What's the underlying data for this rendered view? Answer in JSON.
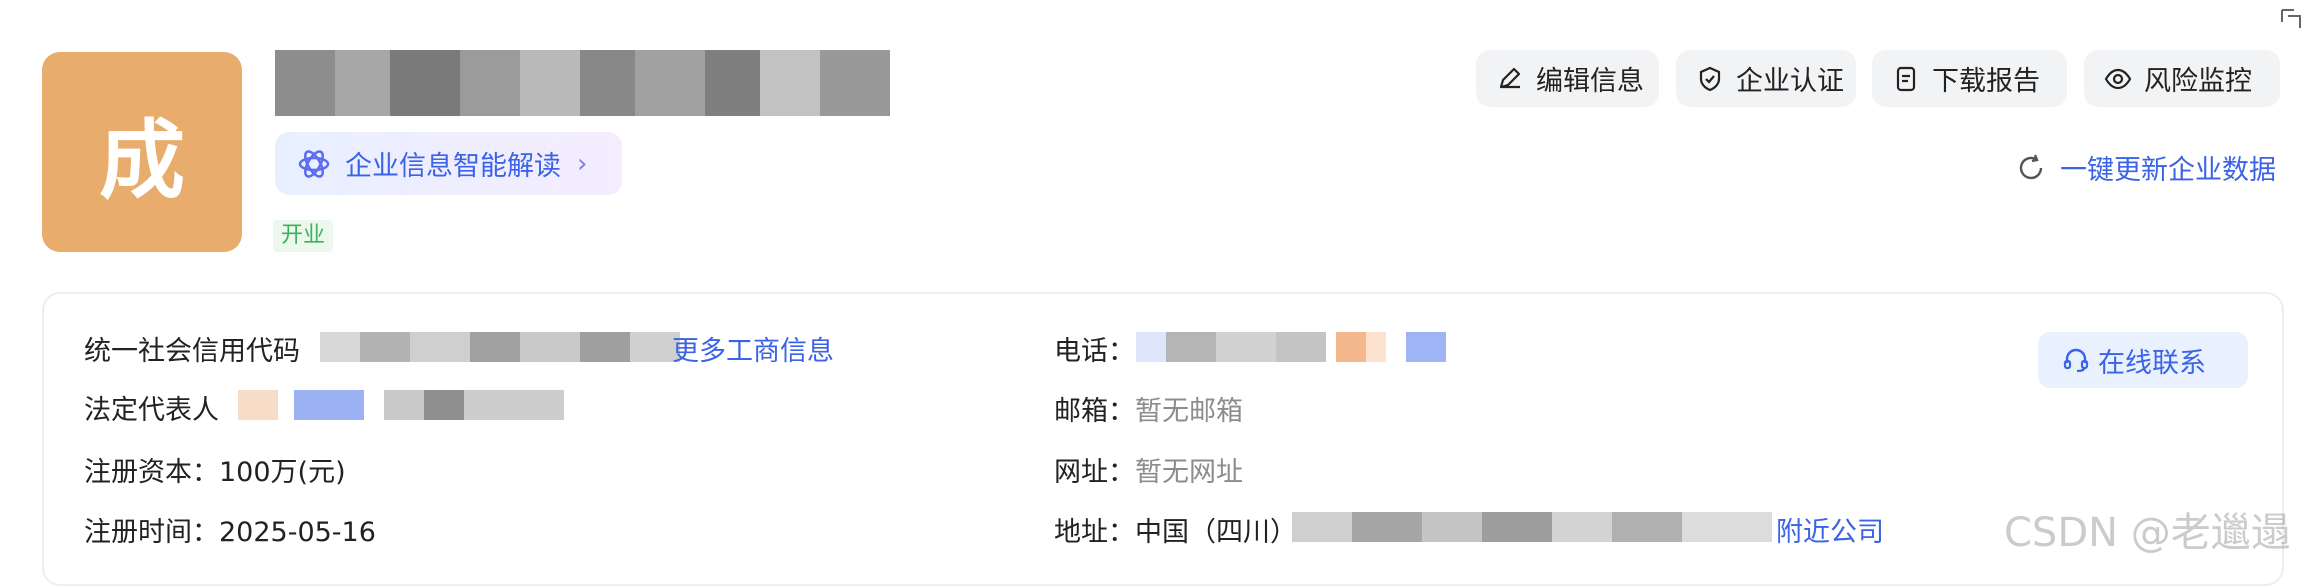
{
  "company": {
    "avatar_char": "成",
    "ai_summary_label": "企业信息智能解读",
    "status": "开业"
  },
  "actions": {
    "edit": "编辑信息",
    "certify": "企业认证",
    "download": "下载报告",
    "monitor": "风险监控",
    "refresh": "一键更新企业数据"
  },
  "info": {
    "credit_code_label": "统一社会信用代码",
    "more_business_link": "更多工商信息",
    "legal_rep_label": "法定代表人",
    "reg_capital_label": "注册资本：",
    "reg_capital_value": "100万(元)",
    "reg_time_label": "注册时间：",
    "reg_time_value": "2025-05-16",
    "phone_label": "电话：",
    "email_label": "邮箱：",
    "email_value": "暂无邮箱",
    "website_label": "网址：",
    "website_value": "暂无网址",
    "address_label": "地址：",
    "address_value": "中国（四川）",
    "nearby_link": "附近公司"
  },
  "contact_button": "在线联系",
  "watermark": "CSDN @老邋遢"
}
